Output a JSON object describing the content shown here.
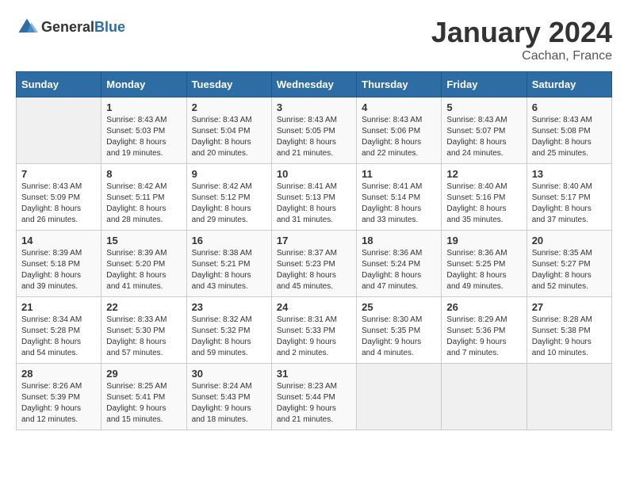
{
  "header": {
    "logo_general": "General",
    "logo_blue": "Blue",
    "month": "January 2024",
    "location": "Cachan, France"
  },
  "calendar": {
    "days_of_week": [
      "Sunday",
      "Monday",
      "Tuesday",
      "Wednesday",
      "Thursday",
      "Friday",
      "Saturday"
    ],
    "weeks": [
      [
        {
          "day": "",
          "content": ""
        },
        {
          "day": "1",
          "content": "Sunrise: 8:43 AM\nSunset: 5:03 PM\nDaylight: 8 hours\nand 19 minutes."
        },
        {
          "day": "2",
          "content": "Sunrise: 8:43 AM\nSunset: 5:04 PM\nDaylight: 8 hours\nand 20 minutes."
        },
        {
          "day": "3",
          "content": "Sunrise: 8:43 AM\nSunset: 5:05 PM\nDaylight: 8 hours\nand 21 minutes."
        },
        {
          "day": "4",
          "content": "Sunrise: 8:43 AM\nSunset: 5:06 PM\nDaylight: 8 hours\nand 22 minutes."
        },
        {
          "day": "5",
          "content": "Sunrise: 8:43 AM\nSunset: 5:07 PM\nDaylight: 8 hours\nand 24 minutes."
        },
        {
          "day": "6",
          "content": "Sunrise: 8:43 AM\nSunset: 5:08 PM\nDaylight: 8 hours\nand 25 minutes."
        }
      ],
      [
        {
          "day": "7",
          "content": "Sunrise: 8:43 AM\nSunset: 5:09 PM\nDaylight: 8 hours\nand 26 minutes."
        },
        {
          "day": "8",
          "content": "Sunrise: 8:42 AM\nSunset: 5:11 PM\nDaylight: 8 hours\nand 28 minutes."
        },
        {
          "day": "9",
          "content": "Sunrise: 8:42 AM\nSunset: 5:12 PM\nDaylight: 8 hours\nand 29 minutes."
        },
        {
          "day": "10",
          "content": "Sunrise: 8:41 AM\nSunset: 5:13 PM\nDaylight: 8 hours\nand 31 minutes."
        },
        {
          "day": "11",
          "content": "Sunrise: 8:41 AM\nSunset: 5:14 PM\nDaylight: 8 hours\nand 33 minutes."
        },
        {
          "day": "12",
          "content": "Sunrise: 8:40 AM\nSunset: 5:16 PM\nDaylight: 8 hours\nand 35 minutes."
        },
        {
          "day": "13",
          "content": "Sunrise: 8:40 AM\nSunset: 5:17 PM\nDaylight: 8 hours\nand 37 minutes."
        }
      ],
      [
        {
          "day": "14",
          "content": "Sunrise: 8:39 AM\nSunset: 5:18 PM\nDaylight: 8 hours\nand 39 minutes."
        },
        {
          "day": "15",
          "content": "Sunrise: 8:39 AM\nSunset: 5:20 PM\nDaylight: 8 hours\nand 41 minutes."
        },
        {
          "day": "16",
          "content": "Sunrise: 8:38 AM\nSunset: 5:21 PM\nDaylight: 8 hours\nand 43 minutes."
        },
        {
          "day": "17",
          "content": "Sunrise: 8:37 AM\nSunset: 5:23 PM\nDaylight: 8 hours\nand 45 minutes."
        },
        {
          "day": "18",
          "content": "Sunrise: 8:36 AM\nSunset: 5:24 PM\nDaylight: 8 hours\nand 47 minutes."
        },
        {
          "day": "19",
          "content": "Sunrise: 8:36 AM\nSunset: 5:25 PM\nDaylight: 8 hours\nand 49 minutes."
        },
        {
          "day": "20",
          "content": "Sunrise: 8:35 AM\nSunset: 5:27 PM\nDaylight: 8 hours\nand 52 minutes."
        }
      ],
      [
        {
          "day": "21",
          "content": "Sunrise: 8:34 AM\nSunset: 5:28 PM\nDaylight: 8 hours\nand 54 minutes."
        },
        {
          "day": "22",
          "content": "Sunrise: 8:33 AM\nSunset: 5:30 PM\nDaylight: 8 hours\nand 57 minutes."
        },
        {
          "day": "23",
          "content": "Sunrise: 8:32 AM\nSunset: 5:32 PM\nDaylight: 8 hours\nand 59 minutes."
        },
        {
          "day": "24",
          "content": "Sunrise: 8:31 AM\nSunset: 5:33 PM\nDaylight: 9 hours\nand 2 minutes."
        },
        {
          "day": "25",
          "content": "Sunrise: 8:30 AM\nSunset: 5:35 PM\nDaylight: 9 hours\nand 4 minutes."
        },
        {
          "day": "26",
          "content": "Sunrise: 8:29 AM\nSunset: 5:36 PM\nDaylight: 9 hours\nand 7 minutes."
        },
        {
          "day": "27",
          "content": "Sunrise: 8:28 AM\nSunset: 5:38 PM\nDaylight: 9 hours\nand 10 minutes."
        }
      ],
      [
        {
          "day": "28",
          "content": "Sunrise: 8:26 AM\nSunset: 5:39 PM\nDaylight: 9 hours\nand 12 minutes."
        },
        {
          "day": "29",
          "content": "Sunrise: 8:25 AM\nSunset: 5:41 PM\nDaylight: 9 hours\nand 15 minutes."
        },
        {
          "day": "30",
          "content": "Sunrise: 8:24 AM\nSunset: 5:43 PM\nDaylight: 9 hours\nand 18 minutes."
        },
        {
          "day": "31",
          "content": "Sunrise: 8:23 AM\nSunset: 5:44 PM\nDaylight: 9 hours\nand 21 minutes."
        },
        {
          "day": "",
          "content": ""
        },
        {
          "day": "",
          "content": ""
        },
        {
          "day": "",
          "content": ""
        }
      ]
    ]
  }
}
